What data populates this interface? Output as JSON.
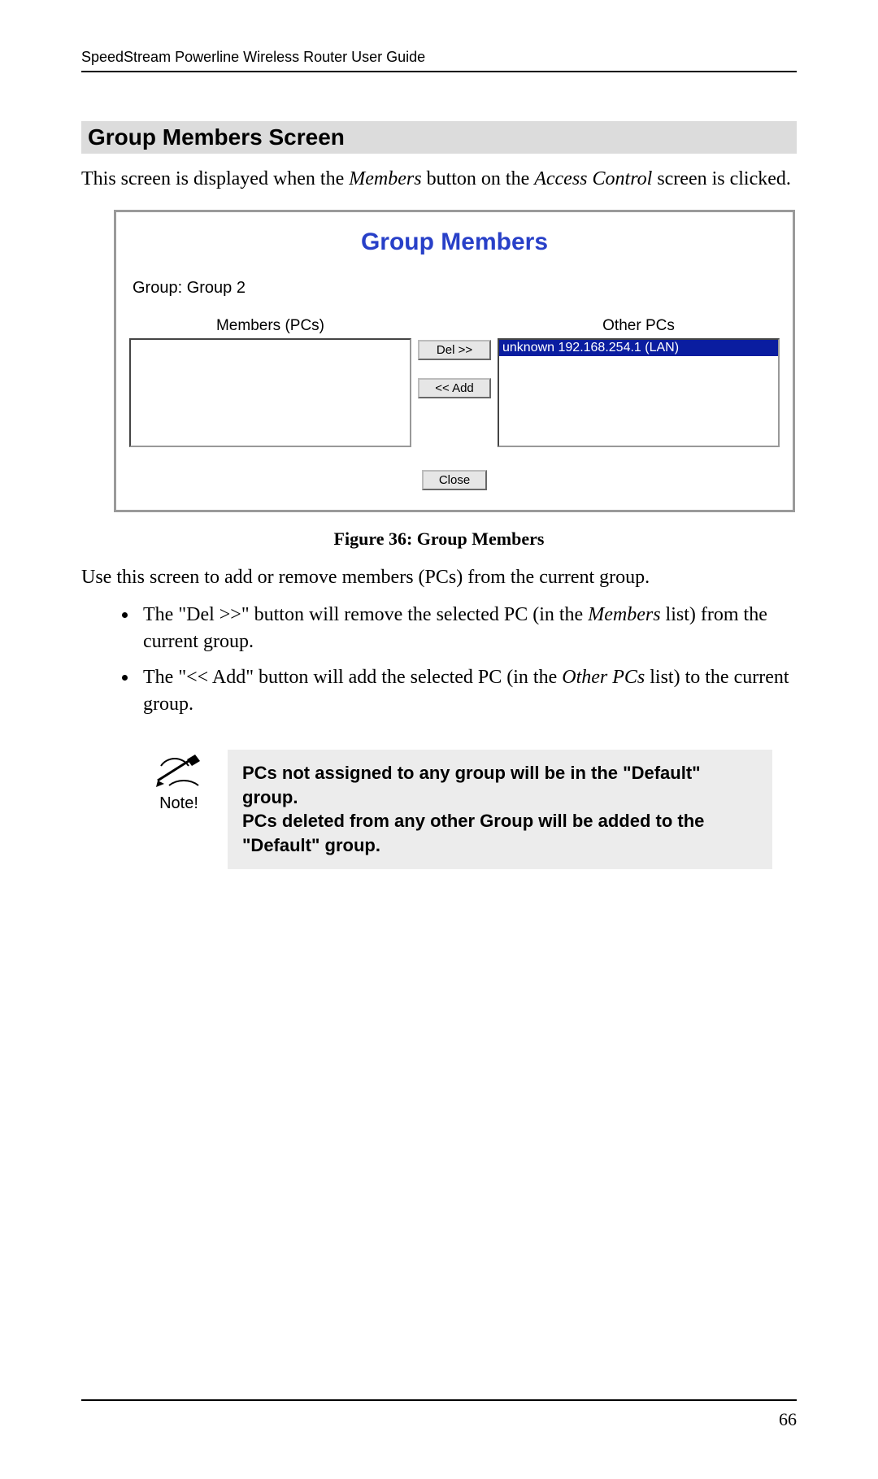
{
  "header": {
    "running": "SpeedStream Powerline Wireless Router User Guide"
  },
  "section": {
    "heading": "Group Members Screen"
  },
  "intro": {
    "p1_a": "This screen is displayed when the ",
    "p1_b": "Members",
    "p1_c": " button on the ",
    "p1_d": "Access Control",
    "p1_e": " screen is clicked."
  },
  "screenshot": {
    "title": "Group Members",
    "group_prefix": "Group: ",
    "group_name": "Group 2",
    "members_label": "Members (PCs)",
    "other_label": "Other PCs",
    "other_items": [
      "unknown 192.168.254.1 (LAN)"
    ],
    "members_items": [],
    "del_label": "Del >>",
    "add_label": "<< Add",
    "close_label": "Close"
  },
  "figure": {
    "caption": "Figure 36: Group Members"
  },
  "usage": {
    "intro": "Use this screen to add or remove members (PCs) from the current group.",
    "bullets": [
      {
        "a": "The \"Del >>\" button will remove the selected PC (in the ",
        "b": "Members",
        "c": " list) from the current group."
      },
      {
        "a": "The \"<< Add\" button will add the selected PC (in the ",
        "b": "Other PCs",
        "c": " list) to the current group."
      }
    ]
  },
  "note": {
    "label": "Note!",
    "line1": "PCs not assigned to any group will be in the \"Default\" group.",
    "line2": "PCs deleted from any other Group will be added to the \"Default\" group."
  },
  "footer": {
    "page_number": "66"
  }
}
